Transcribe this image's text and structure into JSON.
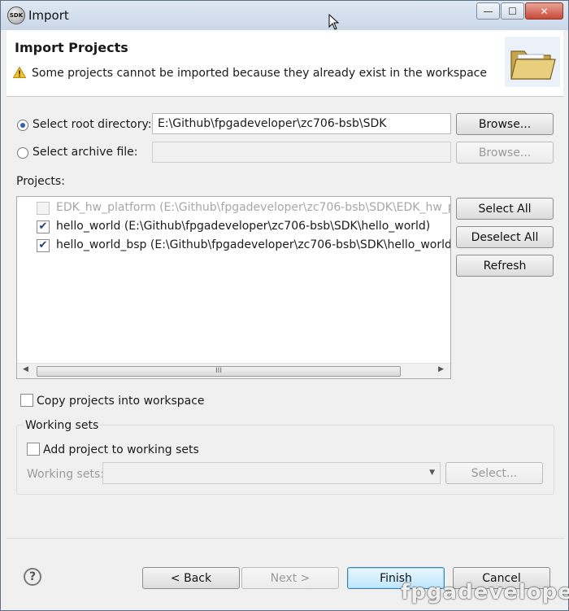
{
  "window": {
    "title": "Import",
    "app_icon_text": "SDK",
    "controls": {
      "minimize": "—",
      "maximize": "☐",
      "close": "✕"
    }
  },
  "banner": {
    "title": "Import Projects",
    "message": "Some projects cannot be imported because they already exist in the workspace"
  },
  "source": {
    "root_label": "Select root directory:",
    "root_value": "E:\\Github\\fpgadeveloper\\zc706-bsb\\SDK",
    "root_selected": true,
    "archive_label": "Select archive file:",
    "archive_value": "",
    "browse_label": "Browse..."
  },
  "projects": {
    "label": "Projects:",
    "items": [
      {
        "text": "EDK_hw_platform (E:\\Github\\fpgadeveloper\\zc706-bsb\\SDK\\EDK_hw_platform)",
        "checked": false,
        "enabled": false
      },
      {
        "text": "hello_world (E:\\Github\\fpgadeveloper\\zc706-bsb\\SDK\\hello_world)",
        "checked": true,
        "enabled": true
      },
      {
        "text": "hello_world_bsp (E:\\Github\\fpgadeveloper\\zc706-bsb\\SDK\\hello_world_bsp)",
        "checked": true,
        "enabled": true
      }
    ],
    "select_all": "Select All",
    "deselect_all": "Deselect All",
    "refresh": "Refresh",
    "scroll_grip": "III"
  },
  "options": {
    "copy_label": "Copy projects into workspace",
    "copy_checked": false
  },
  "working_sets": {
    "group_label": "Working sets",
    "add_label": "Add project to working sets",
    "add_checked": false,
    "sets_label": "Working sets:",
    "sets_value": "",
    "select_label": "Select..."
  },
  "footer": {
    "help": "?",
    "back": "< Back",
    "next": "Next >",
    "finish": "Finish",
    "cancel": "Cancel"
  },
  "watermark": "fpgadeveloper"
}
